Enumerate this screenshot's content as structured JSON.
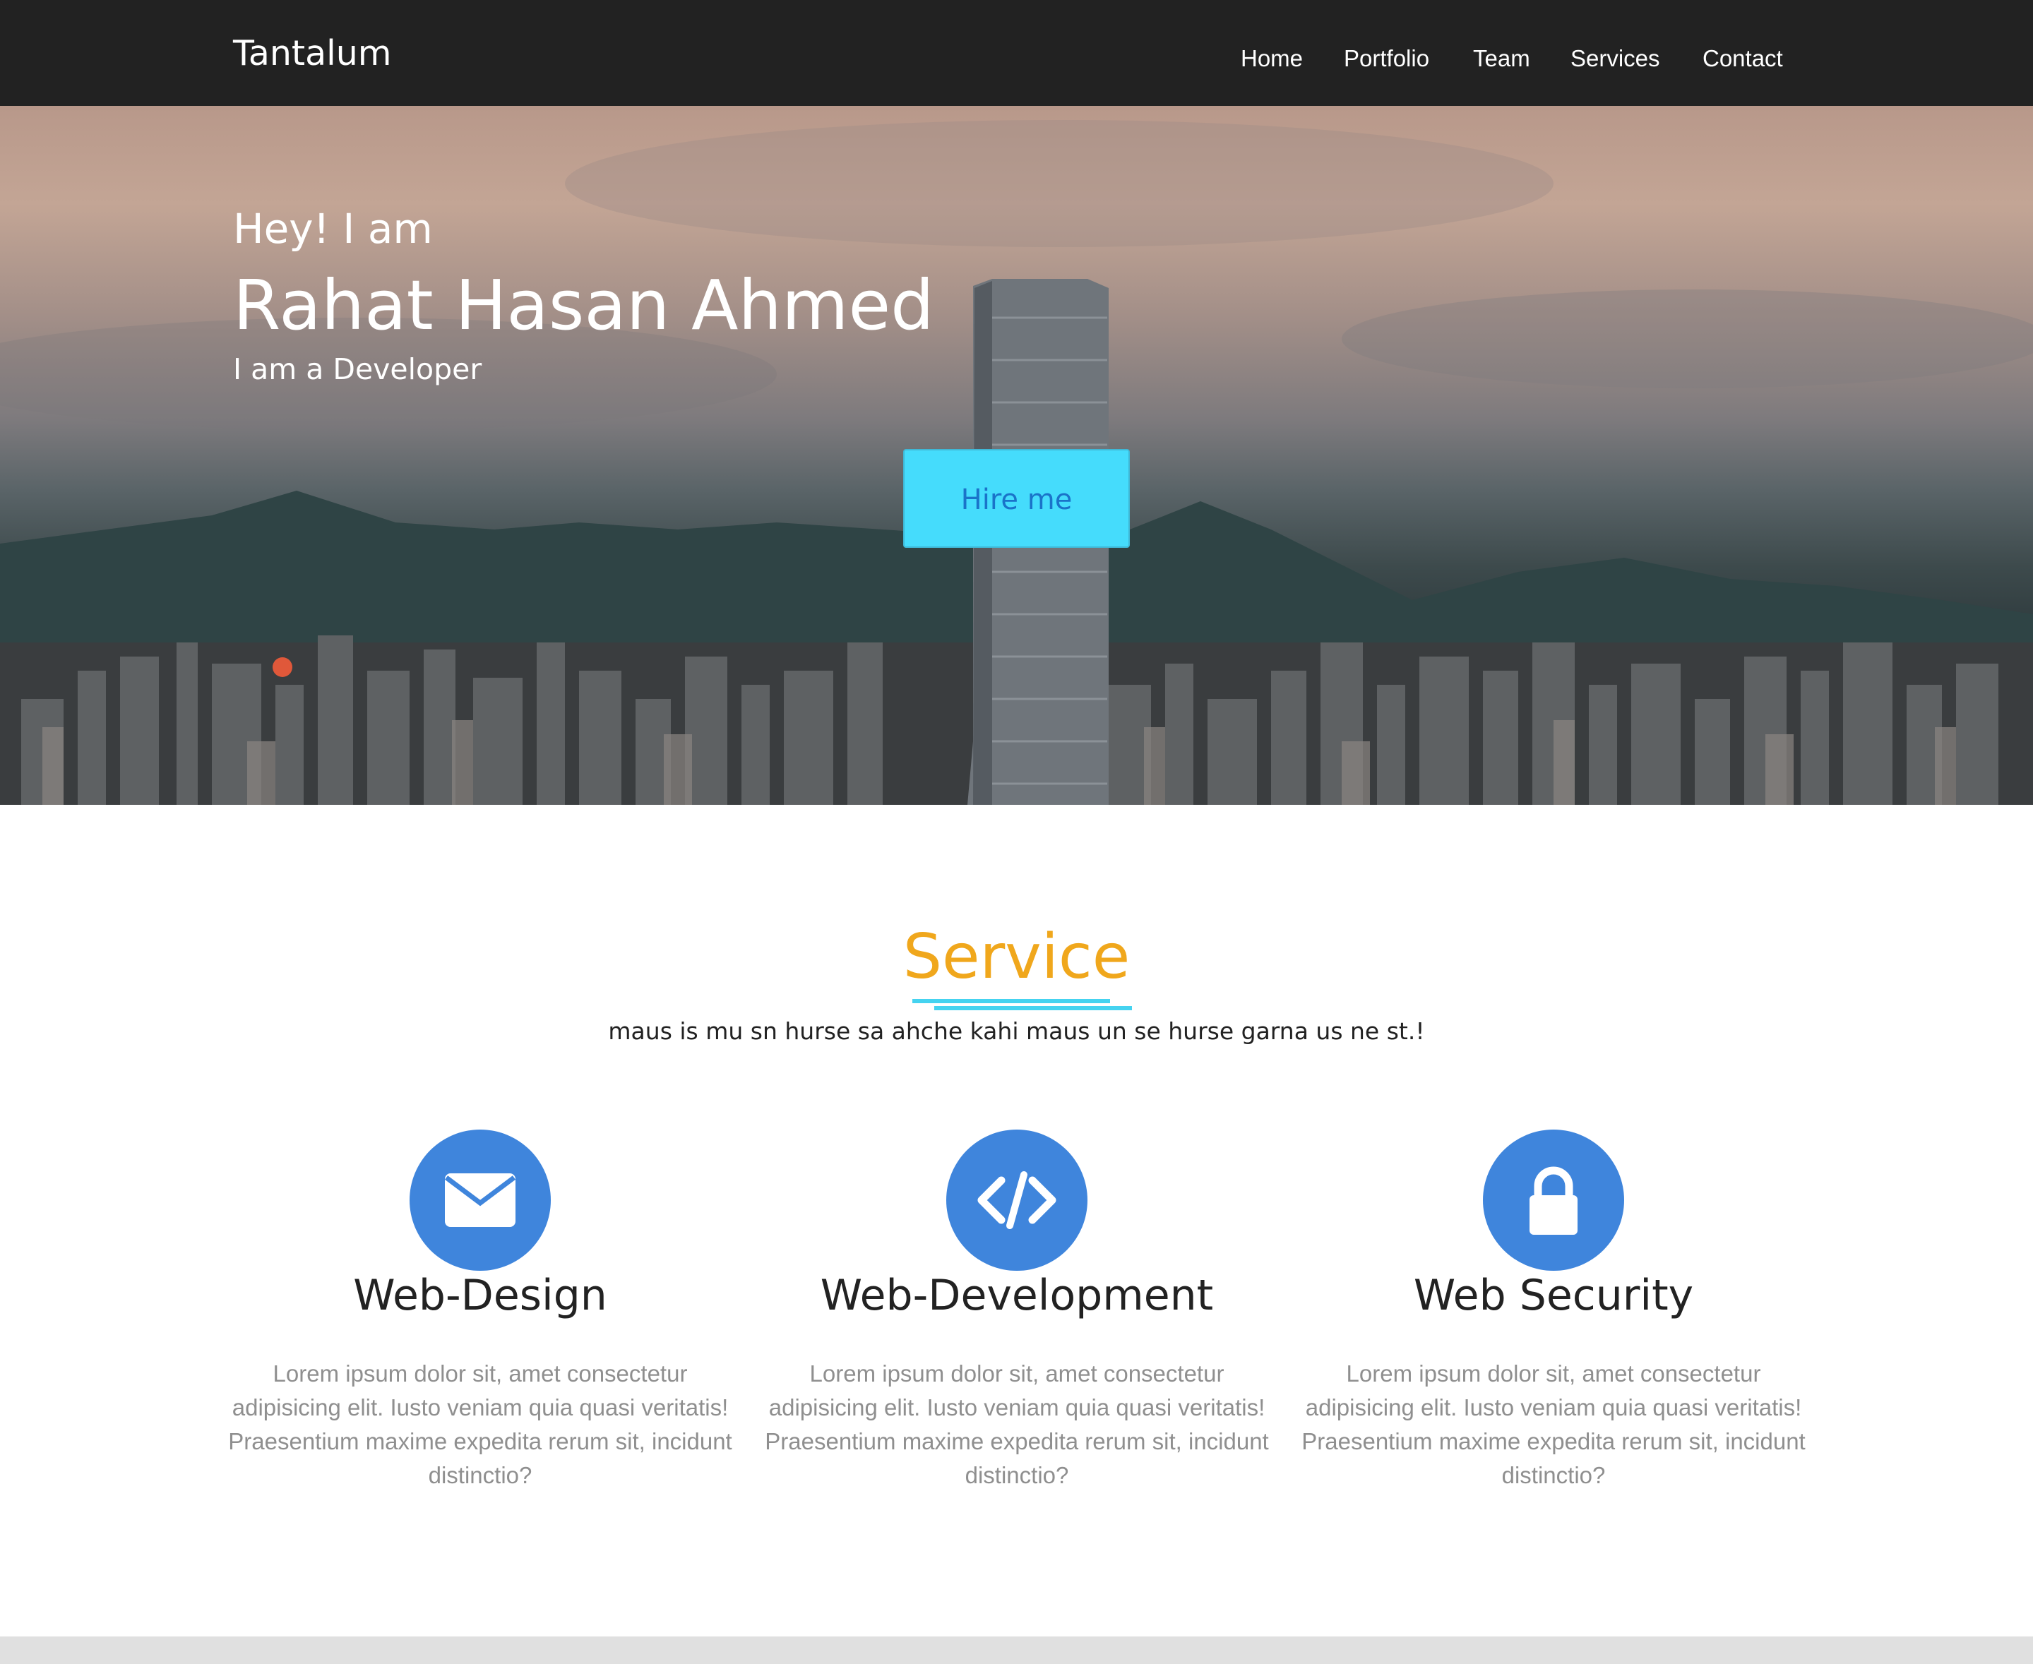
{
  "navbar": {
    "brand": "Tantalum",
    "links": [
      "Home",
      "Portfolio",
      "Team",
      "Services",
      "Contact"
    ]
  },
  "hero": {
    "greeting": "Hey! I am",
    "name": "Rahat Hasan Ahmed",
    "role": "I am a Developer",
    "cta_label": "Hire me"
  },
  "services": {
    "title": "Service",
    "subtitle": "maus is mu sn hurse sa ahche kahi maus un se hurse garna us ne st.!",
    "cards": [
      {
        "icon": "envelope-icon",
        "title": "Web-Design",
        "text": "Lorem ipsum dolor sit, amet consectetur adipisicing elit. Iusto veniam quia quasi veritatis! Praesentium maxime expedita rerum sit, incidunt distinctio?"
      },
      {
        "icon": "code-icon",
        "title": "Web-Development",
        "text": "Lorem ipsum dolor sit, amet consectetur adipisicing elit. Iusto veniam quia quasi veritatis! Praesentium maxime expedita rerum sit, incidunt distinctio?"
      },
      {
        "icon": "lock-icon",
        "title": "Web Security",
        "text": "Lorem ipsum dolor sit, amet consectetur adipisicing elit. Iusto veniam quia quasi veritatis! Praesentium maxime expedita rerum sit, incidunt distinctio?"
      }
    ]
  },
  "colors": {
    "navbar_bg": "#222222",
    "accent_orange": "#f0a71c",
    "accent_cyan": "#45dcfc",
    "icon_blue": "#3f85dc",
    "body_text_gray": "#8f8f8f"
  }
}
